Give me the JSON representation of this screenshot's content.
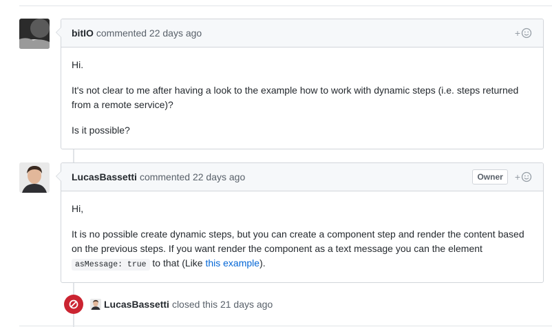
{
  "comments": [
    {
      "author": "bitIO",
      "meta": "commented 22 days ago",
      "paragraphs": [
        "Hi.",
        "It's not clear to me after having a look to the example how to work with dynamic steps (i.e. steps returned from a remote service)?",
        "Is it possible?"
      ]
    },
    {
      "author": "LucasBassetti",
      "meta": "commented 22 days ago",
      "badge": "Owner",
      "paragraphs": [
        "Hi,"
      ],
      "p2_text": "It is no possible create dynamic steps, but you can create a component step and render the content based on the previous steps. If you want render the component as a text message you can the element ",
      "p2_code": "asMessage: true",
      "p2_after_code": " to that (Like ",
      "p2_link": "this example",
      "p2_end": ")."
    }
  ],
  "event": {
    "author": "LucasBassetti",
    "text": "closed this 21 days ago"
  },
  "icons": {
    "reaction": "add-reaction-icon",
    "closed": "closed-circle-icon"
  },
  "colors": {
    "link": "#0366d6",
    "closed": "#cb2431"
  }
}
